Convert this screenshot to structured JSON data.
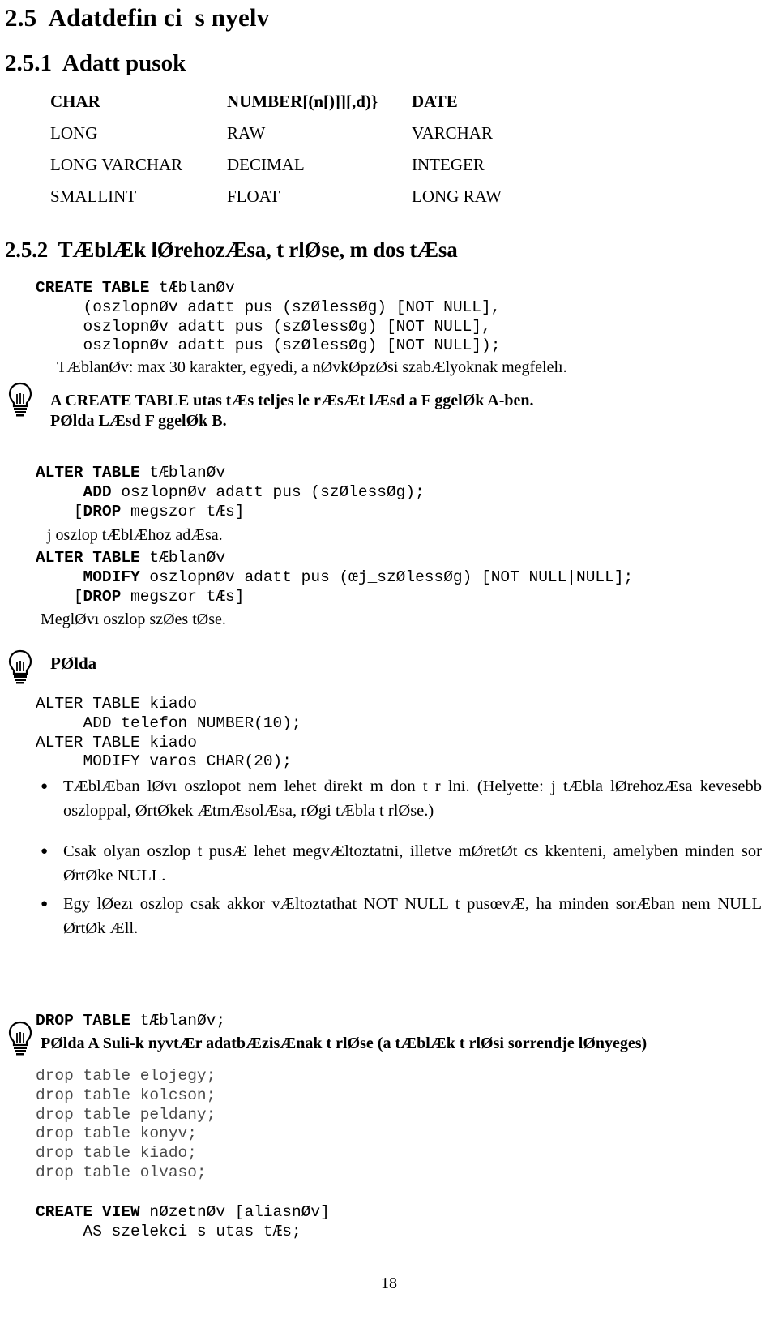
{
  "document": {
    "page_number": "18",
    "section_title": "2.5  Adatdefin ci  s nyelv",
    "subsection_1_title": "2.5.1  Adatt pusok",
    "subsection_2_title": "2.5.2  TÆblÆk lØrehozÆsa, t rlØse, m dos tÆsa"
  },
  "datatypes": {
    "rows": [
      {
        "col1": "CHAR",
        "col2": "NUMBER[(n[)]][,d)}",
        "col3": "DATE",
        "bold": true
      },
      {
        "col1": "LONG",
        "col2": "RAW",
        "col3": "VARCHAR",
        "bold": false
      },
      {
        "col1": "LONG VARCHAR",
        "col2": "DECIMAL",
        "col3": "INTEGER",
        "bold": false
      },
      {
        "col1": "SMALLINT",
        "col2": "FLOAT",
        "col3": "LONG RAW",
        "bold": false
      }
    ]
  },
  "create_table": {
    "line1_keyword": "CREATE TABLE",
    "line1_rest": " tÆblanØv",
    "line2": "     (oszlopnØv adatt pus (szØlessØg) [NOT NULL],",
    "line3": "     oszlopnØv adatt pus (szØlessØg) [NOT NULL],",
    "line4": "     oszlopnØv adatt pus (szØlessØg) [NOT NULL]);",
    "note": "TÆblanØv: max 30 karakter, egyedi, a nØvkØpzØsi szabÆlyoknak megfelelı."
  },
  "tip_create": {
    "line1": "A CREATE TABLE utas tÆs teljes le rÆsÆt lÆsd a F ggelØk A-ben.",
    "line2": "PØlda LÆsd F ggelØk B."
  },
  "alter_add": {
    "line1_keyword": "ALTER TABLE",
    "line1_rest": " tÆblanØv",
    "line2_keyword": "ADD",
    "line2_rest": " oszlopnØv adatt pus (szØlessØg);",
    "line3_prefix": "[",
    "line3_keyword": "DROP",
    "line3_rest": " megszor tÆs]",
    "note": "j oszlop tÆblÆhoz adÆsa."
  },
  "alter_modify": {
    "line1_keyword": "ALTER TABLE",
    "line1_rest": " tÆblanØv",
    "line2_keyword": "MODIFY",
    "line2_rest": " oszlopnØv adatt pus (œj_szØlessØg) [NOT NULL|NULL];",
    "line3_prefix": "[",
    "line3_keyword": "DROP",
    "line3_rest": " megszor tÆs]",
    "note": "MeglØvı oszlop szØes tØse."
  },
  "example_tip": {
    "label": "PØlda"
  },
  "example_code": {
    "line1": "ALTER TABLE kiado",
    "line2": "     ADD telefon NUMBER(10);",
    "line3": "ALTER TABLE kiado",
    "line4": "     MODIFY varos CHAR(20);"
  },
  "bullets": [
    "TÆblÆban lØvı oszlopot nem lehet direkt m don t r lni. (Helyette:   j tÆbla lØrehozÆsa kevesebb oszloppal, ØrtØkek ÆtmÆsolÆsa, rØgi tÆbla t rlØse.)",
    "Csak olyan oszlop t pusÆ lehet megvÆltoztatni, illetve mØretØt cs kkenteni, amelyben minden sor ØrtØke NULL.",
    "Egy lØezı oszlop csak akkor vÆltoztathat  NOT NULL t pusœvÆ, ha minden sorÆban nem NULL ØrtØk Æll."
  ],
  "drop_table": {
    "keyword": "DROP TABLE",
    "rest": " tÆblanØv;",
    "tip": "PØlda A Suli-k nyvtÆr adatbÆzisÆnak t rlØse (a tÆblÆk t rlØsi sorrendje lØnyeges)",
    "statements": [
      "drop table elojegy;",
      "drop table kolcson;",
      "drop table peldany;",
      "drop table konyv;",
      "drop table kiado;",
      "drop table olvaso;"
    ]
  },
  "create_view": {
    "line1_keyword": "CREATE VIEW",
    "line1_rest": " nØzetnØv [aliasnØv]",
    "line2": "     AS szelekci s utas tÆs;"
  },
  "icons": {
    "bulb": "lightbulb-icon",
    "bullet": "bullet-dot-icon"
  }
}
